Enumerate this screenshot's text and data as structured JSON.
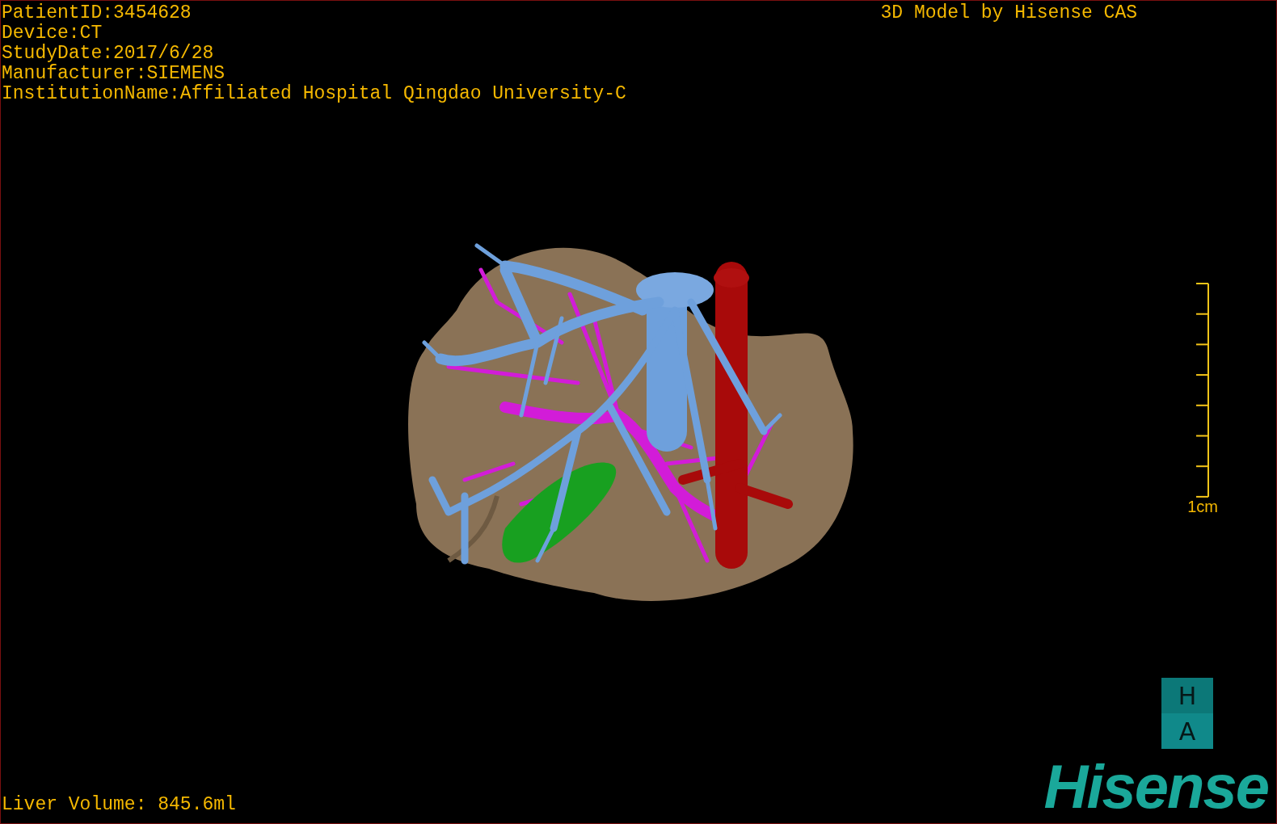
{
  "info_lines": [
    "PatientID:3454628",
    "Device:CT",
    "StudyDate:2017/6/28",
    "Manufacturer:SIEMENS",
    "InstitutionName:Affiliated Hospital Qingdao University-C"
  ],
  "title": "3D Model by Hisense CAS",
  "scale_bar": {
    "label": "1cm"
  },
  "orientation_cube": {
    "faces": [
      "H",
      "A"
    ]
  },
  "logo": "Hisense",
  "liver_volume": "Liver Volume: 845.6ml"
}
